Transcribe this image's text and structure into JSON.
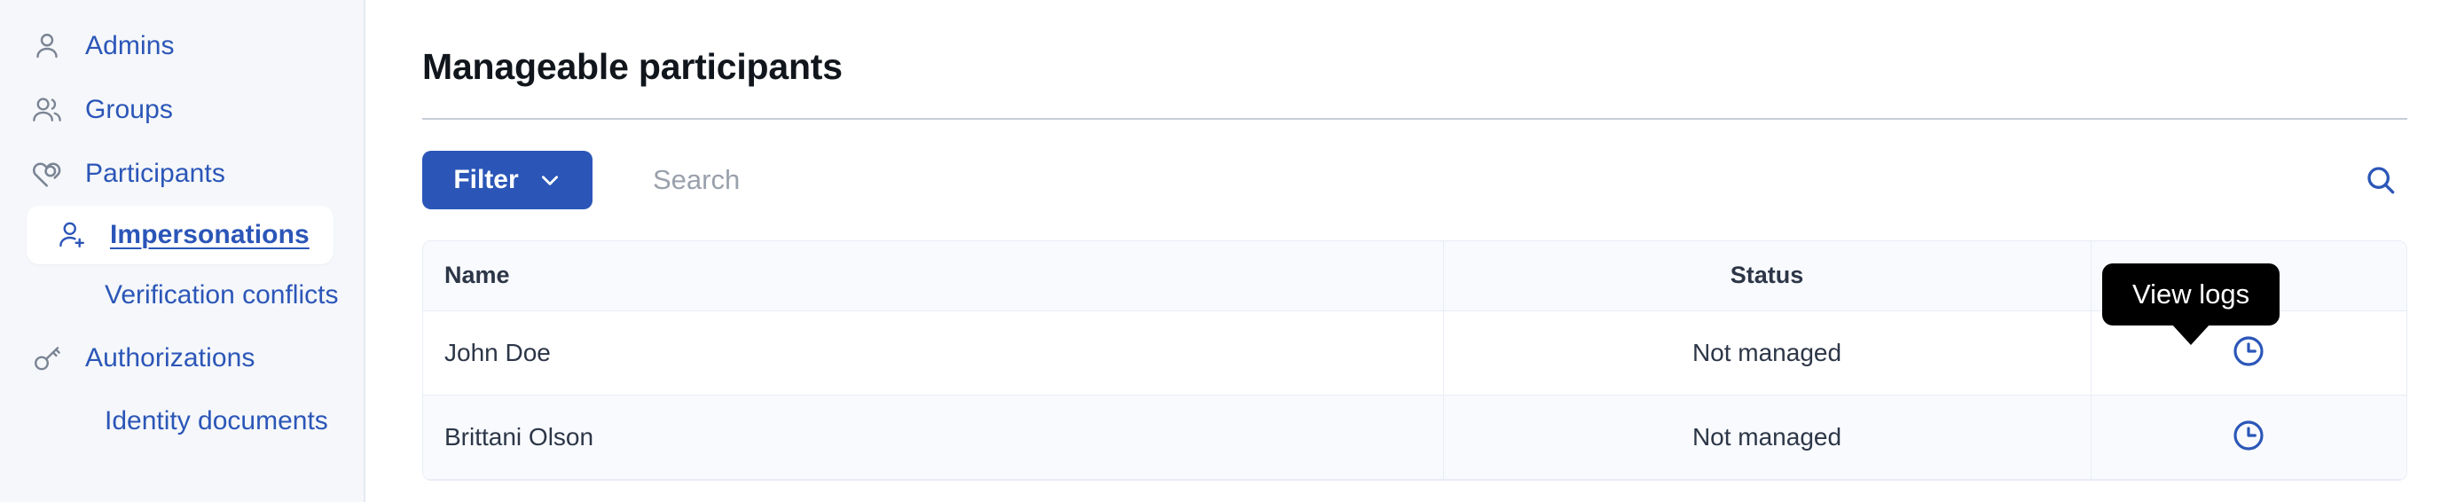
{
  "sidebar": {
    "items": [
      {
        "label": "Admins",
        "icon": "user-icon",
        "type": "top",
        "active": false
      },
      {
        "label": "Groups",
        "icon": "users-icon",
        "type": "top",
        "active": false
      },
      {
        "label": "Participants",
        "icon": "heart-link-icon",
        "type": "top",
        "active": false
      },
      {
        "label": "Impersonations",
        "icon": "user-plus-icon",
        "type": "top",
        "active": true
      },
      {
        "label": "Verification conflicts",
        "icon": "",
        "type": "sub",
        "active": false
      },
      {
        "label": "Authorizations",
        "icon": "key-icon",
        "type": "top",
        "active": false
      },
      {
        "label": "Identity documents",
        "icon": "",
        "type": "sub",
        "active": false
      }
    ]
  },
  "main": {
    "page_title": "Manageable participants",
    "toolbar": {
      "filter_label": "Filter",
      "filter_chevron_icon": "chevron-down-icon",
      "search_placeholder": "Search",
      "search_value": "",
      "search_icon": "search-icon"
    },
    "table": {
      "columns": [
        "Name",
        "Status",
        ""
      ],
      "rows": [
        {
          "name": "John Doe",
          "status": "Not managed",
          "action_icon": "clock-icon"
        },
        {
          "name": "Brittani Olson",
          "status": "Not managed",
          "action_icon": "clock-icon"
        }
      ]
    },
    "tooltip": {
      "text": "View logs"
    }
  },
  "colors": {
    "accent_blue": "#2b56b8",
    "sidebar_bg": "#f5f7fa",
    "icon_gray": "#7b8494",
    "tooltip_bg": "#000000",
    "row_alt_bg": "#f8fafd",
    "border": "#e8edf5"
  }
}
